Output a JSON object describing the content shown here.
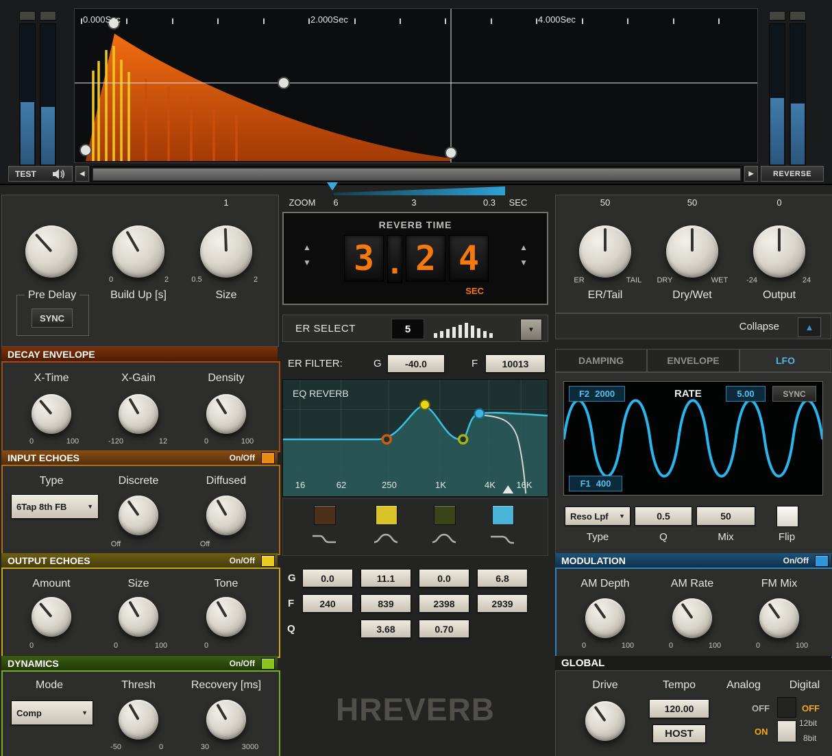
{
  "colors": {
    "digit_orange": "#f5790f",
    "envelope_orange": "#e8570e",
    "lfo_cyan": "#2cb4ec",
    "value_beige": "#ded9cd"
  },
  "transport": {
    "time_labels": [
      "0.000Sec",
      "2.000Sec",
      "4.000Sec"
    ],
    "test": "TEST",
    "reverse": "REVERSE"
  },
  "zoom": {
    "label": "ZOOM",
    "t1": "6",
    "t2": "3",
    "t3": "0.3",
    "unit": "SEC"
  },
  "main": {
    "pre_delay": {
      "label": "Pre Delay",
      "sync": "SYNC"
    },
    "build_up": {
      "label": "Build Up [s]",
      "min": "0",
      "max": "2"
    },
    "size": {
      "label": "Size",
      "top": "1",
      "min": "0.5",
      "max": "2"
    }
  },
  "decay": {
    "header": "DECAY ENVELOPE",
    "knobs": [
      {
        "label": "X-Time",
        "min": "0",
        "max": "100"
      },
      {
        "label": "X-Gain",
        "min": "-120",
        "max": "12"
      },
      {
        "label": "Density",
        "min": "0",
        "max": "100"
      }
    ]
  },
  "input_echoes": {
    "header": "INPUT ECHOES",
    "onoff": "On/Off",
    "type_label": "Type",
    "type_value": "6Tap 8th FB",
    "knobs": [
      {
        "label": "Discrete",
        "min": "Off",
        "max": ""
      },
      {
        "label": "Diffused",
        "min": "Off",
        "max": ""
      }
    ]
  },
  "output_echoes": {
    "header": "OUTPUT ECHOES",
    "onoff": "On/Off",
    "knobs": [
      {
        "label": "Amount",
        "min": "0",
        "max": ""
      },
      {
        "label": "Size",
        "min": "0",
        "max": "100"
      },
      {
        "label": "Tone",
        "min": "0",
        "max": ""
      }
    ]
  },
  "dynamics": {
    "header": "DYNAMICS",
    "onoff": "On/Off",
    "mode_label": "Mode",
    "mode_value": "Comp",
    "knobs": [
      {
        "label": "Thresh",
        "min": "-50",
        "max": "0"
      },
      {
        "label": "Recovery [ms]",
        "min": "30",
        "max": "3000"
      }
    ]
  },
  "reverb_time": {
    "title": "REVERB TIME",
    "digits": [
      "3",
      ".",
      "2",
      "4"
    ],
    "value": "3.24",
    "unit": "SEC"
  },
  "er_select": {
    "label": "ER SELECT",
    "value": "5"
  },
  "er_filter": {
    "label": "ER FILTER:",
    "g_label": "G",
    "g_value": "-40.0",
    "f_label": "F",
    "f_value": "10013"
  },
  "eq": {
    "title": "EQ REVERB",
    "freqs": [
      "16",
      "62",
      "250",
      "1K",
      "4K",
      "16K"
    ],
    "row_g": "G",
    "row_f": "F",
    "row_q": "Q",
    "g_values": [
      "0.0",
      "11.1",
      "0.0",
      "6.8"
    ],
    "f_values": [
      "240",
      "839",
      "2398",
      "2939"
    ],
    "q_values": [
      "3.68",
      "0.70"
    ],
    "band_colors": [
      "#4a3018",
      "#d8c428",
      "#3a4418",
      "#48b4d8"
    ]
  },
  "logo": {
    "text": "HREVERB"
  },
  "mix": {
    "er_tail": {
      "label": "ER/Tail",
      "value": "50",
      "min": "ER",
      "max": "TAIL"
    },
    "dry_wet": {
      "label": "Dry/Wet",
      "value": "50",
      "min": "DRY",
      "max": "WET"
    },
    "output": {
      "label": "Output",
      "value": "0",
      "min": "-24",
      "max": "24"
    }
  },
  "collapse": {
    "label": "Collapse"
  },
  "tabs": {
    "damping": "DAMPING",
    "envelope": "ENVELOPE",
    "lfo": "LFO"
  },
  "lfo": {
    "f2_label": "F2",
    "f2_value": "2000",
    "rate_label": "RATE",
    "rate_value": "5.00",
    "sync": "SYNC",
    "f1_label": "F1",
    "f1_value": "400",
    "type_value": "Reso Lpf",
    "q_value": "0.5",
    "mix_value": "50",
    "type_label": "Type",
    "q_label": "Q",
    "mix_label": "Mix",
    "flip_label": "Flip"
  },
  "modulation": {
    "header": "MODULATION",
    "onoff": "On/Off",
    "knobs": [
      {
        "label": "AM Depth",
        "min": "0",
        "max": "100"
      },
      {
        "label": "AM Rate",
        "min": "0",
        "max": "100"
      },
      {
        "label": "FM Mix",
        "min": "0",
        "max": "100"
      }
    ]
  },
  "global": {
    "header": "GLOBAL",
    "drive_label": "Drive",
    "tempo_label": "Tempo",
    "tempo_value": "120.00",
    "host": "HOST",
    "analog_label": "Analog",
    "analog_off": "OFF",
    "analog_on": "ON",
    "digital_label": "Digital",
    "digital_off": "OFF",
    "digital_12bit": "12bit",
    "digital_8bit": "8bit"
  }
}
